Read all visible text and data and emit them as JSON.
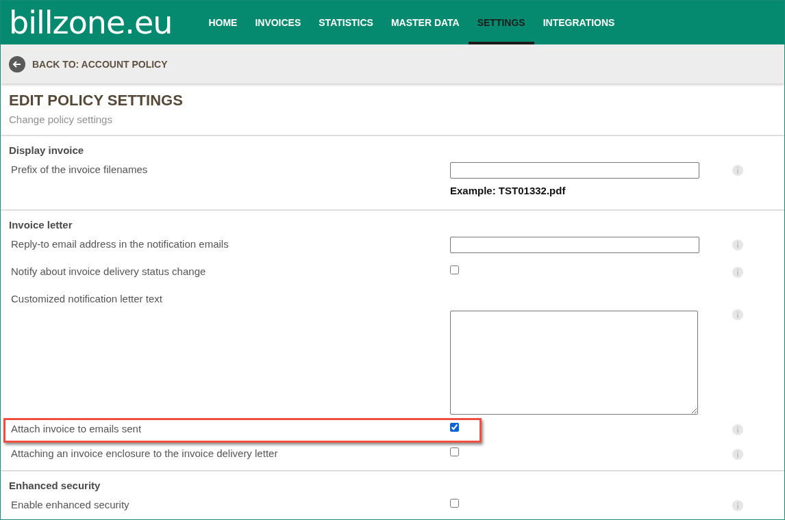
{
  "logo": "billzone.eu",
  "nav": [
    {
      "label": "HOME",
      "selected": false
    },
    {
      "label": "INVOICES",
      "selected": false
    },
    {
      "label": "STATISTICS",
      "selected": false
    },
    {
      "label": "MASTER DATA",
      "selected": false
    },
    {
      "label": "SETTINGS",
      "selected": true
    },
    {
      "label": "INTEGRATIONS",
      "selected": false
    }
  ],
  "back_link": "BACK TO: ACCOUNT POLICY",
  "page_title": "EDIT POLICY SETTINGS",
  "page_subtitle": "Change policy settings",
  "sections": [
    {
      "title": "Display invoice",
      "rows": [
        {
          "kind": "text",
          "label": "Prefix of the invoice filenames",
          "note": "Example: TST01332.pdf",
          "highlighted": false
        }
      ]
    },
    {
      "title": "Invoice letter",
      "rows": [
        {
          "kind": "text",
          "label": "Reply-to email address in the notification emails",
          "highlighted": false
        },
        {
          "kind": "checkbox",
          "label": "Notify about invoice delivery status change",
          "checked": false,
          "highlighted": false
        },
        {
          "kind": "textarea",
          "label": "Customized notification letter text",
          "highlighted": false
        },
        {
          "kind": "checkbox",
          "label": "Attach invoice to emails sent",
          "checked": true,
          "highlighted": true
        },
        {
          "kind": "checkbox",
          "label": "Attaching an invoice enclosure to the invoice delivery letter",
          "checked": false,
          "highlighted": false
        }
      ]
    },
    {
      "title": "Enhanced security",
      "rows": [
        {
          "kind": "checkbox",
          "label": "Enable enhanced security",
          "checked": false,
          "highlighted": false
        }
      ]
    }
  ]
}
